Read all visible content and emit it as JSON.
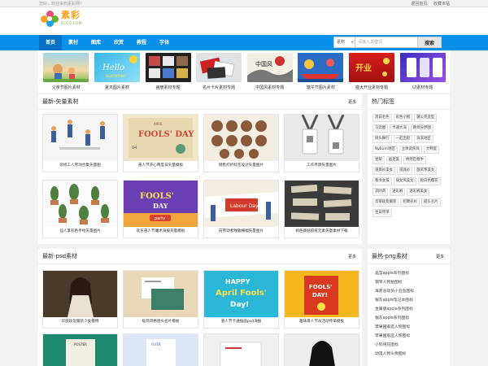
{
  "topbar": {
    "greeting": "您好，欢迎来到素彩网！",
    "links": [
      "返回首页",
      "收藏本站"
    ]
  },
  "logo": {
    "cn": "素彩",
    "en": "SCCO.COM"
  },
  "nav": {
    "items": [
      "首页",
      "素材",
      "图库",
      "欣赏",
      "教程",
      "字体"
    ],
    "active_index": 0
  },
  "search": {
    "select_value": "素材",
    "placeholder": "请输入关键词",
    "button": "搜索"
  },
  "banner": [
    {
      "caption": "父亲节图片素材"
    },
    {
      "caption": "夏天图片素材"
    },
    {
      "caption": "画册素材专题"
    },
    {
      "caption": "名片卡片素材专题"
    },
    {
      "caption": "中国风素材专题"
    },
    {
      "caption": "端午节图片素材"
    },
    {
      "caption": "盛大开业素材专题"
    },
    {
      "caption": "UI素材专题"
    }
  ],
  "vector_section": {
    "title": "最新-矢量素材",
    "more": "更多",
    "cards": [
      {
        "caption": "装修工人劳动合集矢量图"
      },
      {
        "caption": "愚人节开心两度日矢量模板"
      },
      {
        "caption": "销售打折标签设计矢量图片"
      },
      {
        "caption": "工作吊牌矢量图片"
      },
      {
        "caption": "仙人掌彩色手绘矢量图片"
      },
      {
        "caption": "欢乐愚人节魔术海报矢量模板"
      },
      {
        "caption": "向劳动者致敬横幅矢量图片"
      },
      {
        "caption": "棕色撕贴胶纸元素矢量素材下载"
      }
    ]
  },
  "psd_section": {
    "title": "最新-psd素材",
    "more": "更多",
    "cards": [
      {
        "caption": "华丽玫及服装少女模特"
      },
      {
        "caption": "极简风格德头名片模板"
      },
      {
        "caption": "愚人节卡通插画psd海报"
      },
      {
        "caption": "趣味愚人节AI活动传单模板"
      },
      {
        "caption": ""
      },
      {
        "caption": ""
      },
      {
        "caption": ""
      },
      {
        "caption": ""
      }
    ]
  },
  "hot_tags": {
    "title": "热门标签",
    "tags": [
      "黑白毛色",
      "彩色小猪",
      "蒲公英造型",
      "马云图",
      "卡通大海",
      "教师分伊图",
      "街头舞行",
      "一起出街",
      "海滨地区",
      "Nyburn地区",
      "立体武侠风",
      "大鸭蛋",
      "划桨",
      "画足美",
      "桥然巴格牛",
      "道具纱美女",
      "道具纱",
      "放风筝美女",
      "看书女孩",
      "侠女风美女",
      "粉白色樱花",
      "流叶荷",
      "迷彩裤",
      "迷彩裤美女",
      "华丽玫及服装",
      "招聘名片",
      "提头名片",
      "生日传单"
    ]
  },
  "hot_png": {
    "title": "最热-png素材",
    "more": "更多",
    "items": [
      "晶莹apple系列图标",
      "钢琴人物拍图标",
      "海底总动员小丑鱼图标",
      "银灰apple笔记本图标",
      "金属版apple系列图标",
      "银灰apple系列图标",
      "苹果国家庭人物图标",
      "苹果国家庭人物图标",
      "小熊纯花图标",
      "动漫人物头像图标"
    ]
  },
  "colors": {
    "nav_bg": "#0a90e8",
    "nav_active": "#0072c6",
    "logo_orange": "#f7a21b",
    "logo_green": "#6bb12e"
  }
}
